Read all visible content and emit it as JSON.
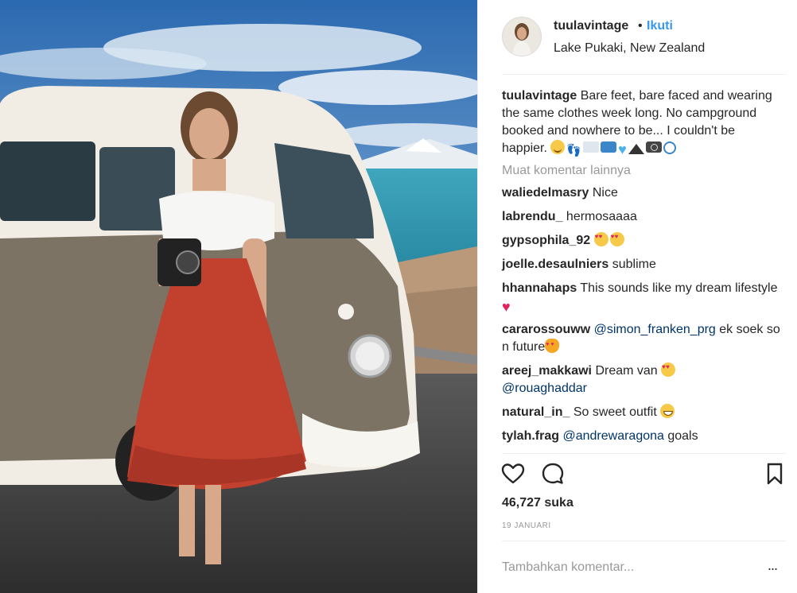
{
  "post": {
    "username": "tuulavintage",
    "separator": "•",
    "follow_label": "Ikuti",
    "location": "Lake Pukaki, New Zealand"
  },
  "caption": {
    "username": "tuulavintage",
    "text": "Bare feet, bare faced and wearing the same clothes week long. No campground booked and nowhere to be... I couldn't be happier."
  },
  "load_more_label": "Muat komentar lainnya",
  "comments": [
    {
      "user": "waliedelmasry",
      "text": "Nice"
    },
    {
      "user": "labrendu_",
      "text": "hermosaaaa"
    },
    {
      "user": "gypsophila_92",
      "text": ""
    },
    {
      "user": "joelle.desaulniers",
      "text": "sublime"
    },
    {
      "user": "hhannahaps",
      "text": "This sounds like my dream lifestyle"
    },
    {
      "user": "cararossouww",
      "mention": "@simon_franken_prg",
      "text": "ek soek so n future"
    },
    {
      "user": "areej_makkawi",
      "text": "Dream van",
      "mention": "@rouaghaddar"
    },
    {
      "user": "natural_in_",
      "text": "So sweet outfit"
    },
    {
      "user": "tylah.frag",
      "mention": "@andrewaragona",
      "text": "goals"
    }
  ],
  "likes_label": "46,727 suka",
  "date_label": "19 JANUARI",
  "add_comment_placeholder": "Tambahkan komentar...",
  "more_options_label": "...",
  "icons": {
    "like": "heart-outline-icon",
    "comment": "speech-bubble-icon",
    "save": "bookmark-outline-icon",
    "more": "ellipsis-icon"
  },
  "colors": {
    "follow": "#3897f0",
    "mention": "#003569",
    "muted": "#999999",
    "text": "#262626"
  }
}
